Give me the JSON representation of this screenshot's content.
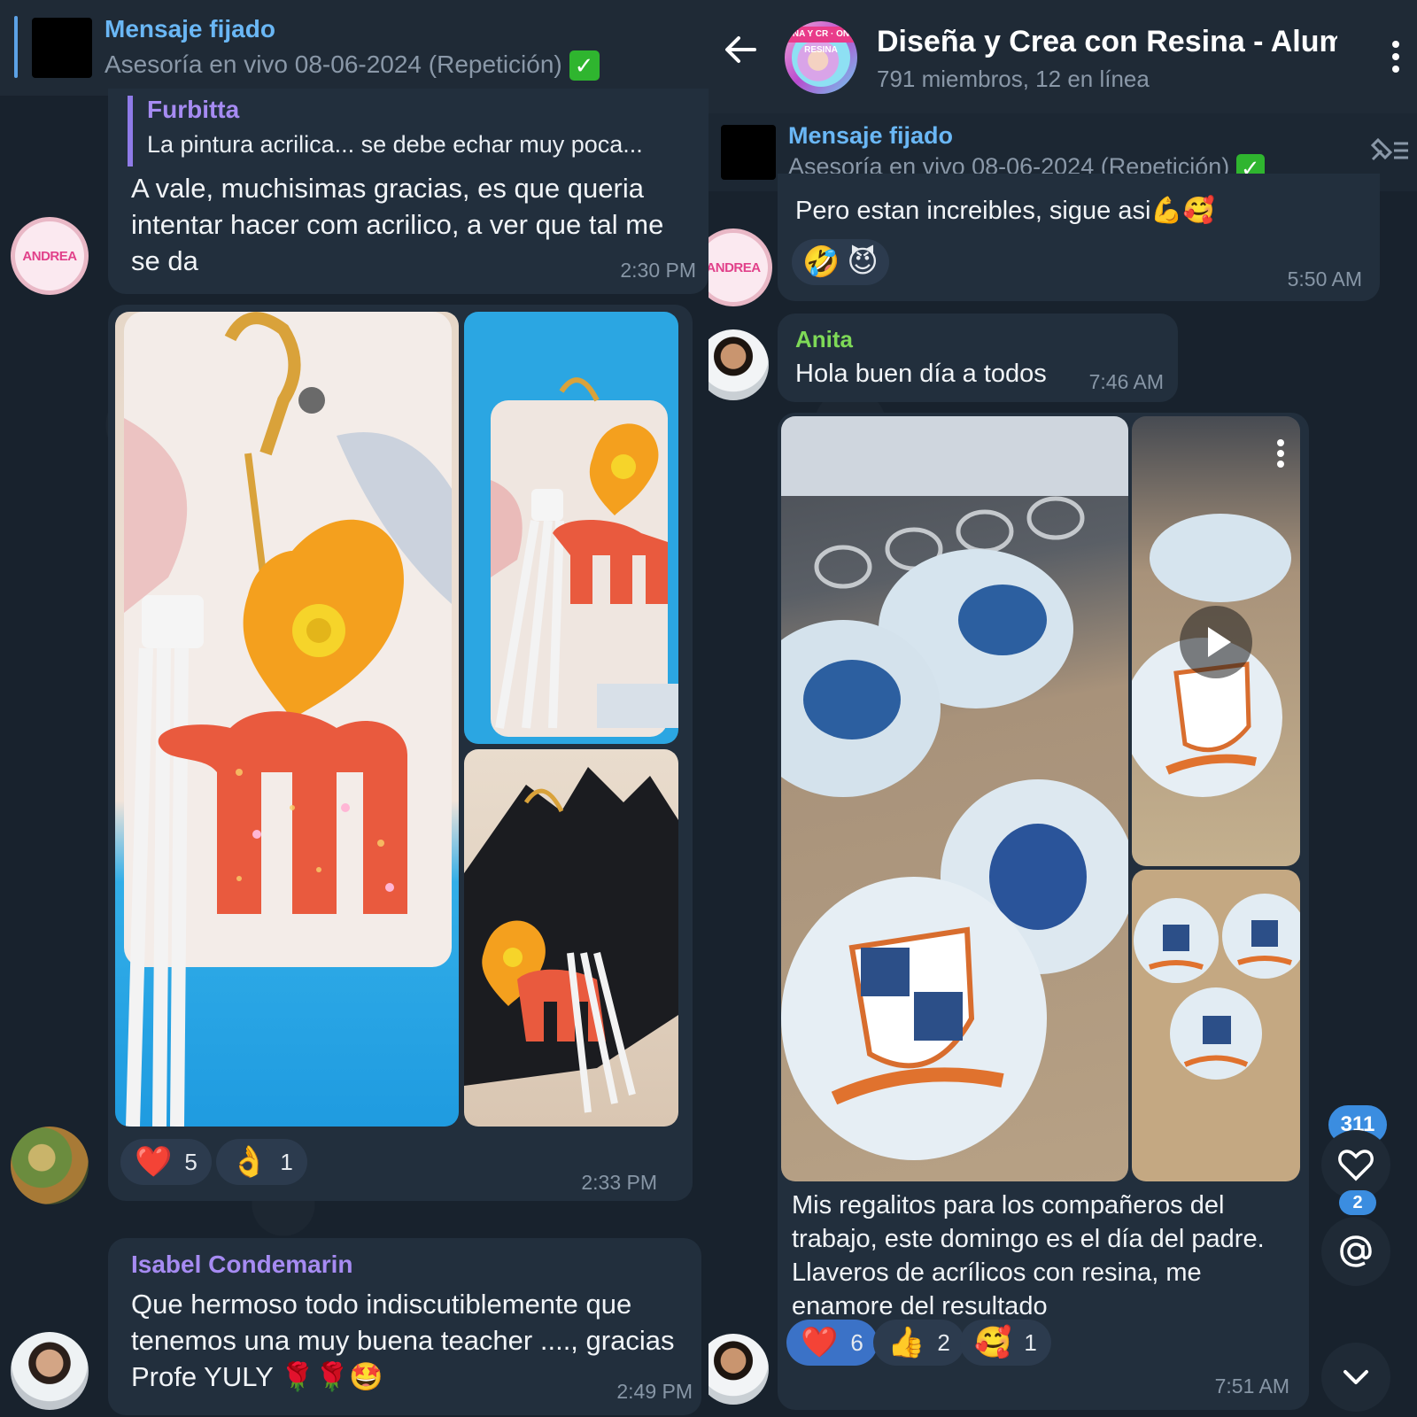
{
  "left": {
    "pinned": {
      "title": "Mensaje fijado",
      "subtitle": "Asesoría en vivo 08-06-2024 (Repetición)",
      "check": "✓"
    },
    "avatars": {
      "andrea_label": "ANDREA"
    },
    "reply_message": {
      "reply_author": "Furbitta",
      "reply_text": "La pintura acrilica... se debe echar muy poca...",
      "text": "A vale, muchisimas gracias, es que queria intentar hacer com acrilico, a ver que tal me se da",
      "time": "2:30 PM"
    },
    "photo_message": {
      "reactions": [
        {
          "emoji": "❤️",
          "count": "5"
        },
        {
          "emoji": "👌",
          "count": "1"
        }
      ],
      "time": "2:33 PM"
    },
    "isabel_message": {
      "author": "Isabel Condemarin",
      "text": "Que hermoso todo indiscutiblemente que tenemos una muy buena teacher ...., gracias Profe YULY 🌹🌹🤩",
      "time": "2:49 PM"
    }
  },
  "right": {
    "header": {
      "title": "Diseña y Crea con Resina - Alumn",
      "subtitle": "791 miembros, 12 en línea",
      "avatar_band": "ÑA Y CR · ON RESINA"
    },
    "pinned": {
      "title": "Mensaje fijado",
      "subtitle": "Asesoría en vivo 08-06-2024 (Repetición)",
      "check": "✓"
    },
    "avatars": {
      "andrea_label": "ANDREA"
    },
    "andrea_message": {
      "text": "Pero estan increibles, sigue asi💪🥰",
      "reactions": [
        {
          "emoji": "🤣"
        },
        {
          "emoji": "😈"
        }
      ],
      "time": "5:50 AM"
    },
    "anita_message": {
      "author": "Anita",
      "text": "Hola buen día a todos",
      "time": "7:46 AM"
    },
    "media_message": {
      "text": "Mis regalitos para los compañeros del trabajo, este domingo es el día del padre. Llaveros de acrílicos con resina, me enamore del resultado",
      "reactions": [
        {
          "emoji": "❤️",
          "count": "6"
        },
        {
          "emoji": "👍",
          "count": "2"
        },
        {
          "emoji": "🥰",
          "count": "1"
        }
      ],
      "time": "7:51 AM"
    },
    "side": {
      "reactions_count": "311",
      "mentions_count": "2"
    }
  },
  "colors": {
    "accent": "#6ab7f5",
    "bubble": "#222f3d",
    "reaction_active": "#3b72c7",
    "anita_name": "#7ed957",
    "isabel_name": "#a68bf2",
    "furbitta_name": "#a68bf2"
  }
}
